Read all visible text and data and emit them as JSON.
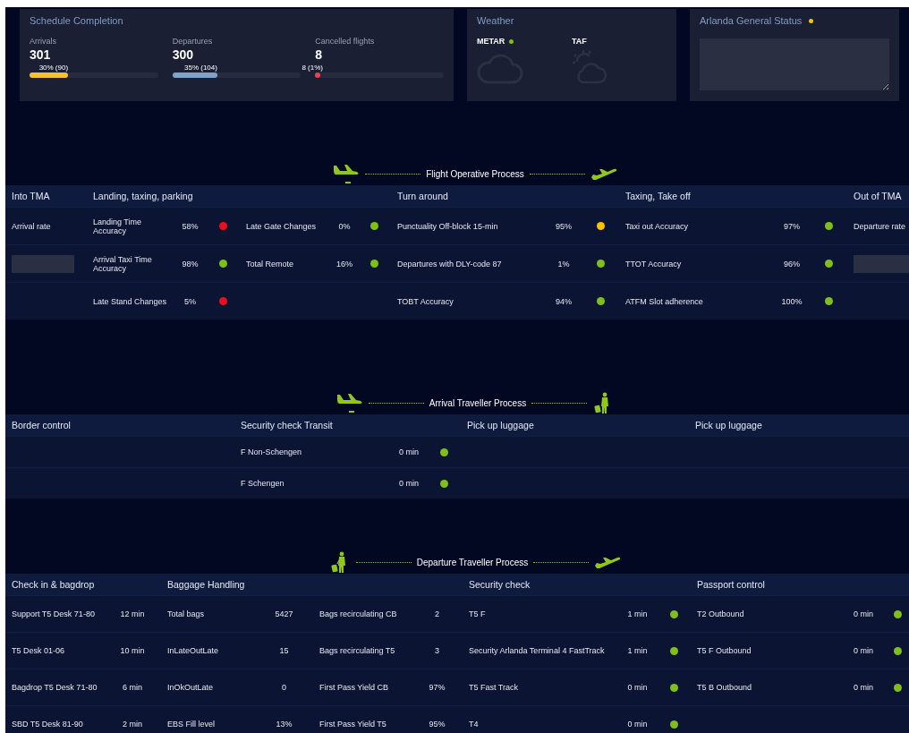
{
  "schedule": {
    "title": "Schedule Completion",
    "items": [
      {
        "label": "Arrivals",
        "count": "301",
        "bar_label": "30% (90)",
        "level": 0.3,
        "color": "#f2c230"
      },
      {
        "label": "Departures",
        "count": "300",
        "bar_label": "35% (104)",
        "level": 0.35,
        "color": "#7ea2c8"
      },
      {
        "label": "Cancelled flights",
        "count": "8",
        "bar_label": "8 (1%)",
        "level": 0.01,
        "color": "#e8434b"
      }
    ]
  },
  "weather": {
    "title": "Weather",
    "items": [
      {
        "label": "METAR",
        "color": "#7fbf1a"
      },
      {
        "label": "TAF"
      }
    ]
  },
  "general_status": {
    "title": "Arlanda General Status",
    "color": "#f5c400"
  },
  "sections": [
    {
      "kind": "flight",
      "title": "Flight Operative Process",
      "headers": [
        "Into TMA",
        "Landing, taxing, parking",
        "Turn around",
        "Taxing, Take off",
        "Out of TMA"
      ],
      "rows": [
        {
          "cells": [
            {
              "kind": "text",
              "text": "Arrival rate"
            },
            {
              "kind": "text",
              "text": "Landing Time Accuracy"
            },
            {
              "kind": "value",
              "text": "58%"
            },
            {
              "kind": "dot",
              "color": "#e8101e"
            },
            {
              "kind": "text",
              "text": "Late Gate Changes"
            },
            {
              "kind": "value",
              "text": "0%"
            },
            {
              "kind": "dot",
              "color": "#7fbf1a"
            },
            {
              "kind": "text",
              "text": "Punctuality Off-block 15-min"
            },
            {
              "kind": "value",
              "text": "95%"
            },
            {
              "kind": "dot",
              "color": "#f5c400"
            },
            {
              "kind": "text",
              "text": "Taxi out Accuracy"
            },
            {
              "kind": "value",
              "text": "97%"
            },
            {
              "kind": "dot",
              "color": "#7fbf1a"
            },
            {
              "kind": "text",
              "text": "Departure rate"
            }
          ]
        },
        {
          "cells": [
            {
              "kind": "box"
            },
            {
              "kind": "text",
              "text": "Arrival Taxi Time Accuracy"
            },
            {
              "kind": "value",
              "text": "98%"
            },
            {
              "kind": "dot",
              "color": "#7fbf1a"
            },
            {
              "kind": "text",
              "text": "Total Remote"
            },
            {
              "kind": "value",
              "text": "16%"
            },
            {
              "kind": "dot",
              "color": "#7fbf1a"
            },
            {
              "kind": "text",
              "text": "Departures with DLY-code 87"
            },
            {
              "kind": "value",
              "text": "1%"
            },
            {
              "kind": "dot",
              "color": "#7fbf1a"
            },
            {
              "kind": "text",
              "text": "TTOT Accuracy"
            },
            {
              "kind": "value",
              "text": "96%"
            },
            {
              "kind": "dot",
              "color": "#7fbf1a"
            },
            {
              "kind": "box"
            }
          ]
        },
        {
          "cells": [
            {
              "kind": "blank"
            },
            {
              "kind": "text",
              "text": "Late Stand Changes"
            },
            {
              "kind": "value",
              "text": "5%"
            },
            {
              "kind": "dot",
              "color": "#e8101e"
            },
            {
              "kind": "blank"
            },
            {
              "kind": "blank"
            },
            {
              "kind": "blank"
            },
            {
              "kind": "text",
              "text": "TOBT Accuracy"
            },
            {
              "kind": "value",
              "text": "94%"
            },
            {
              "kind": "dot",
              "color": "#7fbf1a"
            },
            {
              "kind": "text",
              "text": "ATFM Slot adherence"
            },
            {
              "kind": "value",
              "text": "100%"
            },
            {
              "kind": "dot",
              "color": "#7fbf1a"
            },
            {
              "kind": "blank"
            }
          ]
        }
      ]
    },
    {
      "kind": "arrival",
      "title": "Arrival Traveller Process",
      "headers": [
        "Border control",
        "Security check Transit",
        "Pick up luggage",
        "Pick up luggage"
      ],
      "rows": [
        {
          "cells": [
            {
              "kind": "blank"
            },
            {
              "kind": "text",
              "text": "F Non-Schengen"
            },
            {
              "kind": "value",
              "text": "0 min"
            },
            {
              "kind": "dot",
              "color": "#7fbf1a"
            },
            {
              "kind": "blank"
            },
            {
              "kind": "blank"
            }
          ]
        },
        {
          "cells": [
            {
              "kind": "blank"
            },
            {
              "kind": "text",
              "text": "F Schengen"
            },
            {
              "kind": "value",
              "text": "0 min"
            },
            {
              "kind": "dot",
              "color": "#7fbf1a"
            },
            {
              "kind": "blank"
            },
            {
              "kind": "blank"
            }
          ]
        }
      ]
    },
    {
      "kind": "departure",
      "title": "Departure Traveller Process",
      "headers": [
        "Check in & bagdrop",
        "Baggage Handling",
        "Security check",
        "Passport control"
      ],
      "rows": [
        {
          "cells": [
            {
              "kind": "text",
              "text": "Support T5 Desk 71-80"
            },
            {
              "kind": "value",
              "text": "12 min"
            },
            {
              "kind": "text",
              "text": "Total bags"
            },
            {
              "kind": "value",
              "text": "5427"
            },
            {
              "kind": "text",
              "text": "Bags recirculating CB"
            },
            {
              "kind": "value",
              "text": "2"
            },
            {
              "kind": "text",
              "text": "T5 F"
            },
            {
              "kind": "value",
              "text": "1 min"
            },
            {
              "kind": "dot",
              "color": "#7fbf1a"
            },
            {
              "kind": "text",
              "text": "T2 Outbound"
            },
            {
              "kind": "value",
              "text": "0 min"
            },
            {
              "kind": "dot",
              "color": "#7fbf1a"
            }
          ]
        },
        {
          "cells": [
            {
              "kind": "text",
              "text": "T5 Desk 01-06"
            },
            {
              "kind": "value",
              "text": "10 min"
            },
            {
              "kind": "text",
              "text": "InLateOutLate"
            },
            {
              "kind": "value",
              "text": "15"
            },
            {
              "kind": "text",
              "text": "Bags recirculating T5"
            },
            {
              "kind": "value",
              "text": "3"
            },
            {
              "kind": "text",
              "text": "Security Arlanda Terminal 4 FastTrack"
            },
            {
              "kind": "value",
              "text": "1 min"
            },
            {
              "kind": "dot",
              "color": "#7fbf1a"
            },
            {
              "kind": "text",
              "text": "T5 F Outbound"
            },
            {
              "kind": "value",
              "text": "0 min"
            },
            {
              "kind": "dot",
              "color": "#7fbf1a"
            }
          ]
        },
        {
          "cells": [
            {
              "kind": "text",
              "text": "Bagdrop T5 Desk 71-80"
            },
            {
              "kind": "value",
              "text": "6 min"
            },
            {
              "kind": "text",
              "text": "InOkOutLate"
            },
            {
              "kind": "value",
              "text": "0"
            },
            {
              "kind": "text",
              "text": "First Pass Yield CB"
            },
            {
              "kind": "value",
              "text": "97%"
            },
            {
              "kind": "text",
              "text": "T5 Fast Track"
            },
            {
              "kind": "value",
              "text": "0 min"
            },
            {
              "kind": "dot",
              "color": "#7fbf1a"
            },
            {
              "kind": "text",
              "text": "T5 B Outbound"
            },
            {
              "kind": "value",
              "text": "0 min"
            },
            {
              "kind": "dot",
              "color": "#7fbf1a"
            }
          ]
        },
        {
          "cells": [
            {
              "kind": "text",
              "text": "SBD T5 Desk 81-90"
            },
            {
              "kind": "value",
              "text": "2 min"
            },
            {
              "kind": "text",
              "text": "EBS Fill level"
            },
            {
              "kind": "value",
              "text": "13%"
            },
            {
              "kind": "text",
              "text": "First Pass Yield T5"
            },
            {
              "kind": "value",
              "text": "95%"
            },
            {
              "kind": "text",
              "text": "T4"
            },
            {
              "kind": "value",
              "text": "0 min"
            },
            {
              "kind": "dot",
              "color": "#7fbf1a"
            },
            {
              "kind": "blank"
            },
            {
              "kind": "blank"
            },
            {
              "kind": "blank"
            }
          ]
        }
      ]
    }
  ]
}
